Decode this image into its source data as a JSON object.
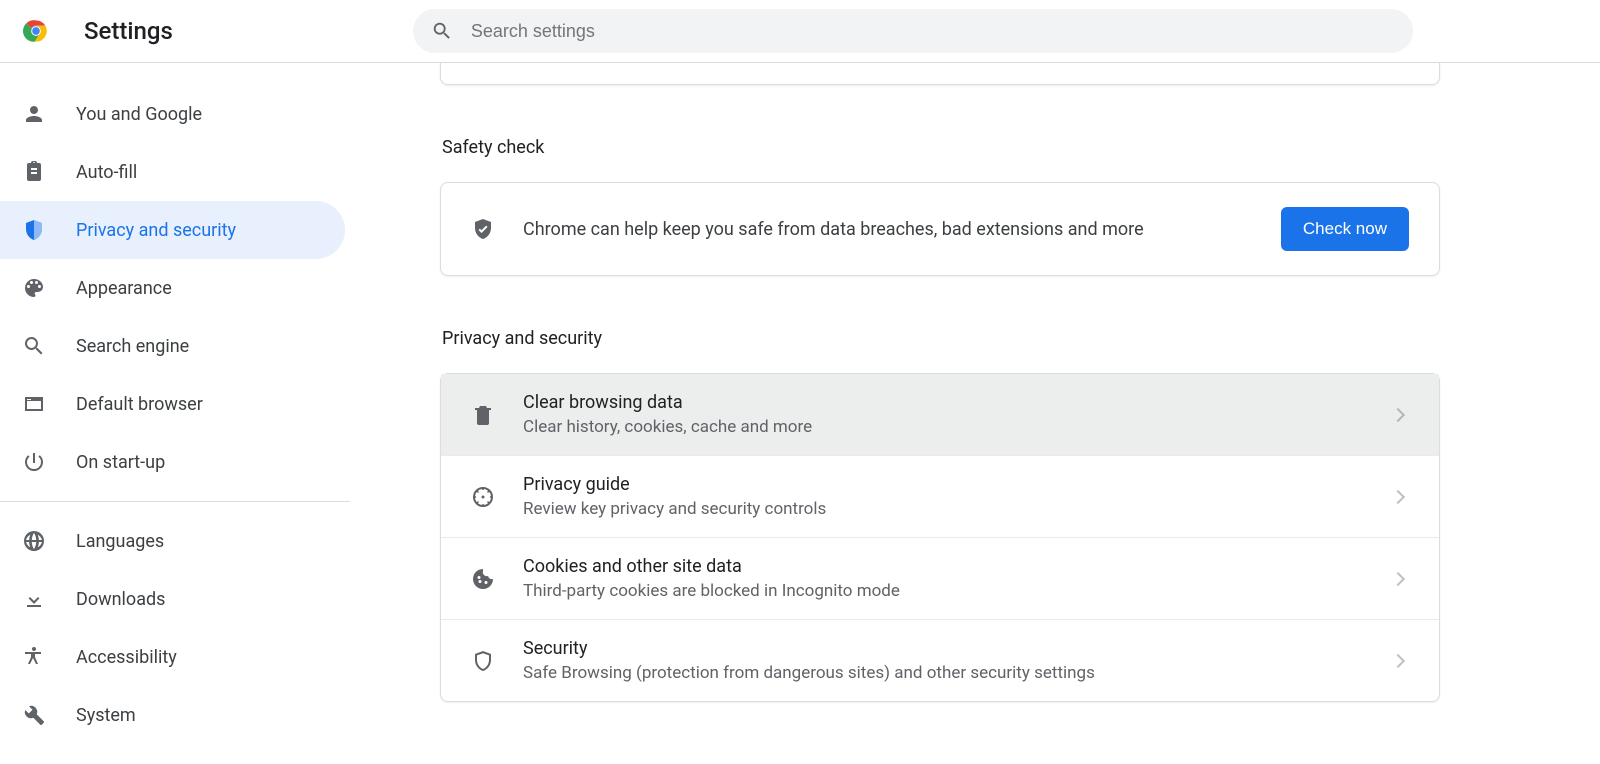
{
  "header": {
    "title": "Settings",
    "search_placeholder": "Search settings"
  },
  "sidebar": {
    "primary": [
      {
        "id": "you-and-google",
        "label": "You and Google",
        "icon": "person"
      },
      {
        "id": "auto-fill",
        "label": "Auto-fill",
        "icon": "clipboard"
      },
      {
        "id": "privacy-and-security",
        "label": "Privacy and security",
        "icon": "shield",
        "active": true
      },
      {
        "id": "appearance",
        "label": "Appearance",
        "icon": "palette"
      },
      {
        "id": "search-engine",
        "label": "Search engine",
        "icon": "search"
      },
      {
        "id": "default-browser",
        "label": "Default browser",
        "icon": "window"
      },
      {
        "id": "on-startup",
        "label": "On start-up",
        "icon": "power"
      }
    ],
    "secondary": [
      {
        "id": "languages",
        "label": "Languages",
        "icon": "globe"
      },
      {
        "id": "downloads",
        "label": "Downloads",
        "icon": "download"
      },
      {
        "id": "accessibility",
        "label": "Accessibility",
        "icon": "accessibility"
      },
      {
        "id": "system",
        "label": "System",
        "icon": "wrench"
      }
    ]
  },
  "sections": {
    "safety": {
      "heading": "Safety check",
      "text": "Chrome can help keep you safe from data breaches, bad extensions and more",
      "button": "Check now"
    },
    "privacy": {
      "heading": "Privacy and security",
      "rows": [
        {
          "id": "clear-browsing-data",
          "title": "Clear browsing data",
          "sub": "Clear history, cookies, cache and more",
          "icon": "trash",
          "hover": true
        },
        {
          "id": "privacy-guide",
          "title": "Privacy guide",
          "sub": "Review key privacy and security controls",
          "icon": "compass"
        },
        {
          "id": "cookies",
          "title": "Cookies and other site data",
          "sub": "Third-party cookies are blocked in Incognito mode",
          "icon": "cookie"
        },
        {
          "id": "security",
          "title": "Security",
          "sub": "Safe Browsing (protection from dangerous sites) and other security settings",
          "icon": "shield-outline"
        }
      ]
    }
  }
}
